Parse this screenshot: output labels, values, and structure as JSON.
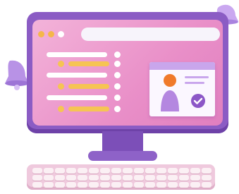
{
  "colors": {
    "frame": "#8b5cc4",
    "screen": "#ee9bd1",
    "accent_yellow": "#f6c453",
    "accent_orange": "#f07a2b",
    "window_dot_1": "#f5b74a",
    "window_dot_2": "#f5b74a",
    "window_dot_3": "#ffffff",
    "text_line": "#ffffff",
    "profile_head": "#f07a2b",
    "profile_body": "#b487e0",
    "check_badge": "#8c57c7"
  },
  "icons": {
    "bell_left": "bell-icon",
    "bell_right": "bell-icon",
    "check": "check-icon",
    "avatar": "user-icon"
  }
}
